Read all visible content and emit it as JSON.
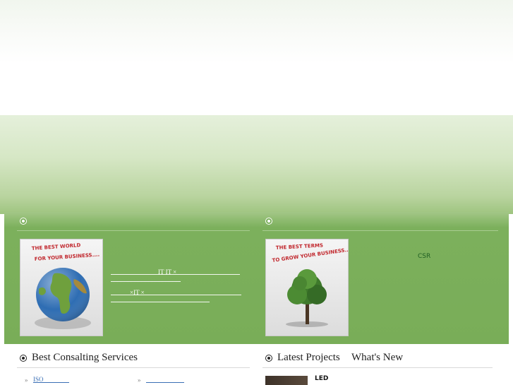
{
  "panels": {
    "left": {
      "thumb_line1": "THE BEST WORLD",
      "thumb_line2": "FOR YOUR BUSINESS....",
      "text_line1": "IT    IT              ×",
      "text_line2": "×IT   ×"
    },
    "right": {
      "thumb_line1": "THE BEST TERMS",
      "thumb_line2": "TO GROW YOUR BUSINESS....",
      "csr_label": "CSR"
    }
  },
  "sections": {
    "services": {
      "title": "Best Consalting Services",
      "links": [
        "ISO",
        ""
      ]
    },
    "projects": {
      "title": "Latest Projects",
      "title2": "What's New",
      "item_label": "LED"
    }
  }
}
